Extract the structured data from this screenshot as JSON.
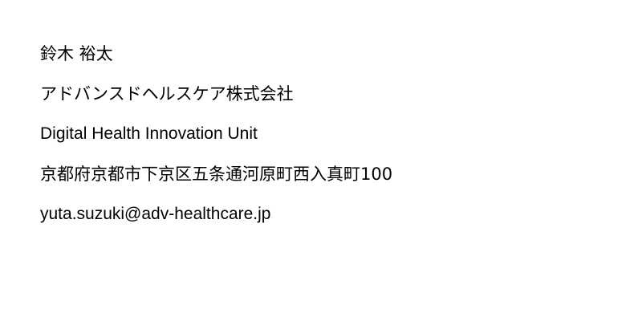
{
  "contact": {
    "name": "鈴木 裕太",
    "company": "アドバンスドヘルスケア株式会社",
    "unit": "Digital Health Innovation Unit",
    "address": "京都府京都市下京区五条通河原町西入真町100",
    "email": "yuta.suzuki@adv-healthcare.jp"
  }
}
